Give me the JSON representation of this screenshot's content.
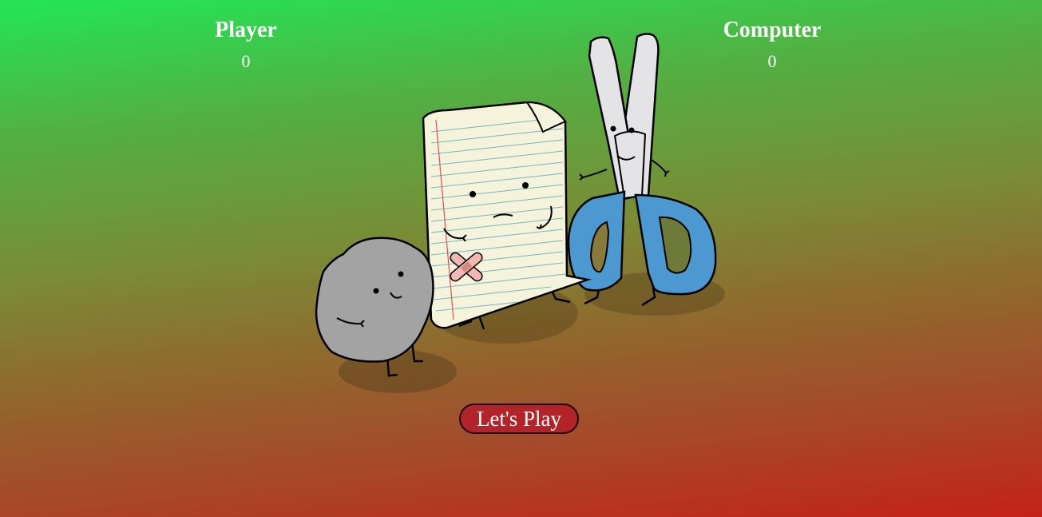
{
  "scoreboard": {
    "player": {
      "label": "Player",
      "score": "0"
    },
    "computer": {
      "label": "Computer",
      "score": "0"
    }
  },
  "illustration": {
    "characters": [
      "rock",
      "paper",
      "scissors"
    ]
  },
  "actions": {
    "play_label": "Let's Play"
  },
  "colors": {
    "gradient_top": "#22e655",
    "gradient_bottom": "#c42218",
    "button_bg": "#b3232a",
    "rock": "#a3a3a3",
    "paper": "#f6f3dc",
    "scissors_handle": "#4c98d0"
  }
}
